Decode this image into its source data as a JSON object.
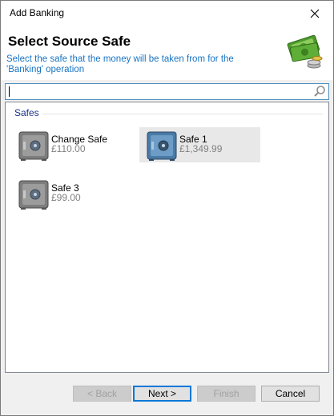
{
  "window": {
    "title": "Add Banking"
  },
  "header": {
    "heading": "Select Source Safe",
    "description": "Select the safe that the money will be taken from for the 'Banking' operation",
    "icon": "cash-money-icon"
  },
  "search": {
    "value": "",
    "placeholder": ""
  },
  "safes": {
    "group_label": "Safes",
    "items": [
      {
        "name": "Change Safe",
        "amount": "£110.00",
        "icon": "grey-safe-icon",
        "selected": false
      },
      {
        "name": "Safe 1",
        "amount": "£1,349.99",
        "icon": "blue-safe-icon",
        "selected": true
      },
      {
        "name": "Safe 3",
        "amount": "£99.00",
        "icon": "grey-safe-icon",
        "selected": false
      }
    ]
  },
  "buttons": {
    "back": "< Back",
    "next": "Next >",
    "finish": "Finish",
    "cancel": "Cancel"
  },
  "colors": {
    "accent": "#0078d7",
    "description_text": "#1874c5",
    "group_header": "#1e3287"
  }
}
